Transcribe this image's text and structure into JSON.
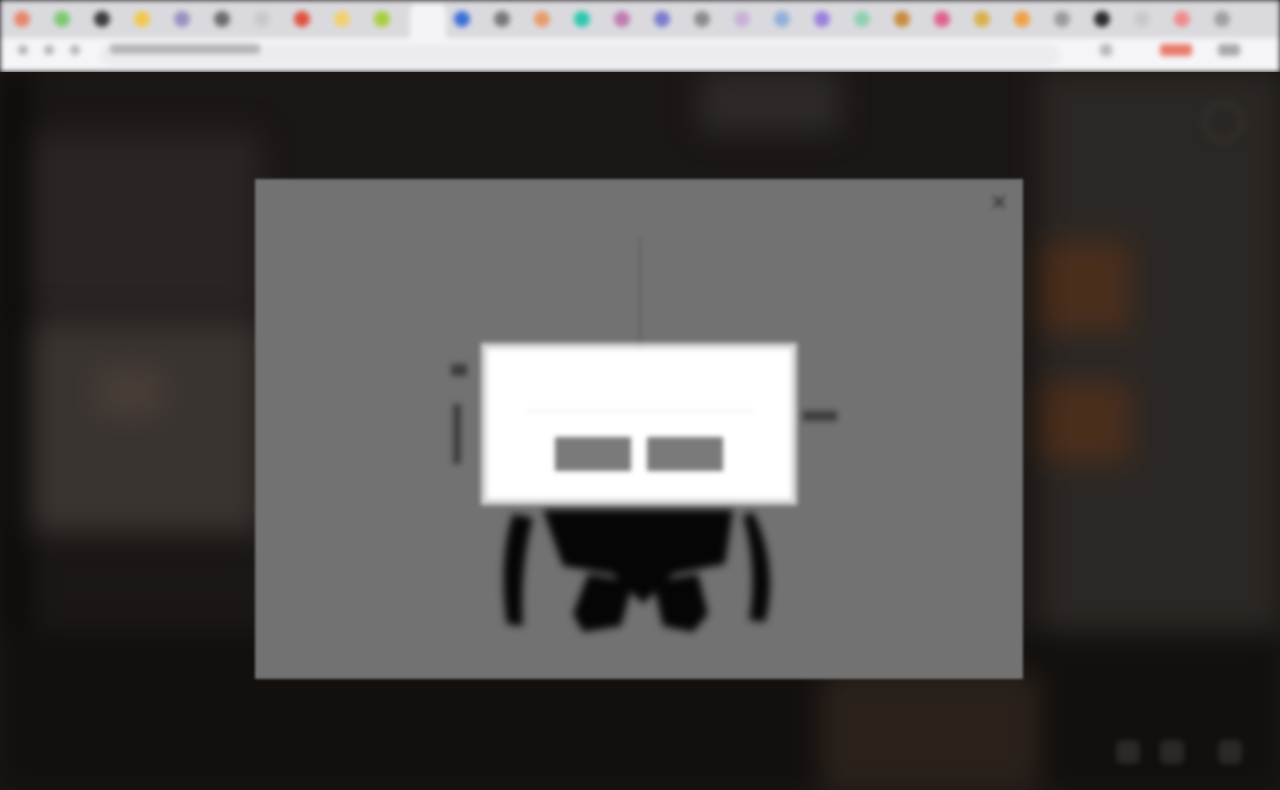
{
  "browser": {
    "tab_favicon_colors": [
      "#e8856a",
      "#7bc96f",
      "#3a3a3a",
      "#f2c84b",
      "#9a8fc0",
      "#6b6b6b",
      "#c9c9c9",
      "#e0503c",
      "#f2d06b",
      "#a6cf3a",
      "#d1453b",
      "#3a6fd8",
      "#777777",
      "#e89a6a",
      "#2cc7b0",
      "#c07ab0",
      "#7a7ad0",
      "#8a8a8a",
      "#c9b0d8",
      "#8fb0d8",
      "#9b7ee0",
      "#8fd0b0",
      "#c98a3a",
      "#e0608a",
      "#d8b04a",
      "#f0a040",
      "#9a9a9a",
      "#2a2a2a",
      "#c9c9c9",
      "#f08a8a",
      "#a0a0a0"
    ],
    "brand_accent": "#e0503c"
  },
  "lightbox": {
    "close_icon": "close-icon",
    "close_glyph": "✕"
  },
  "dialog": {
    "message": "",
    "buttons": [
      {
        "label": ""
      },
      {
        "label": ""
      }
    ]
  },
  "page": {
    "settings_icon": "gear-icon"
  }
}
